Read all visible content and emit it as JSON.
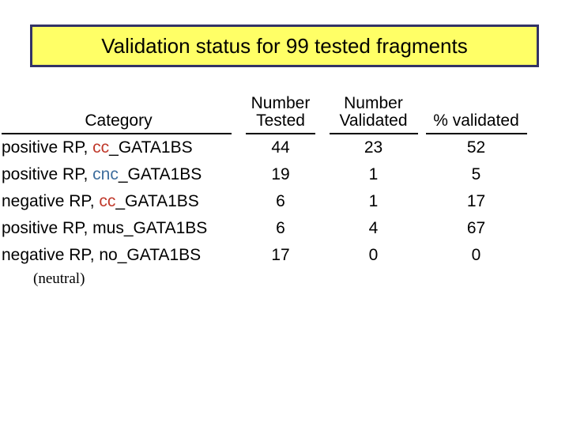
{
  "slide": {
    "background_color": "#ffffff"
  },
  "title": {
    "text": "Validation status for 99 tested fragments",
    "background_color": "#ffff66",
    "border_color": "#333366",
    "text_color": "#000000"
  },
  "table": {
    "headers": {
      "category": "Category",
      "number_tested_line1": "Number",
      "number_tested_line2": "Tested",
      "number_validated_line1": "Number",
      "number_validated_line2": "Validated",
      "percent_validated": "% validated"
    },
    "rows": [
      {
        "prefix": "positive RP, ",
        "token": "cc",
        "token_color": "#C0392B",
        "suffix": "_GATA1BS",
        "number_tested": "44",
        "number_validated": "23",
        "percent_validated": "52"
      },
      {
        "prefix": "positive RP, ",
        "token": "cnc",
        "token_color": "#3E6E9E",
        "suffix": "_GATA1BS",
        "number_tested": "19",
        "number_validated": "1",
        "percent_validated": "5"
      },
      {
        "prefix": "negative RP, ",
        "token": "cc",
        "token_color": "#C0392B",
        "suffix": "_GATA1BS",
        "number_tested": "6",
        "number_validated": "1",
        "percent_validated": "17"
      },
      {
        "prefix": "positive RP, ",
        "token": "mus",
        "token_color": "#000000",
        "suffix": "_GATA1BS",
        "number_tested": "6",
        "number_validated": "4",
        "percent_validated": "67"
      },
      {
        "prefix": "negative RP, ",
        "token": "no",
        "token_color": "#000000",
        "suffix": "_GATA1BS",
        "number_tested": "17",
        "number_validated": "0",
        "percent_validated": "0"
      }
    ],
    "footnote": "(neutral)"
  }
}
